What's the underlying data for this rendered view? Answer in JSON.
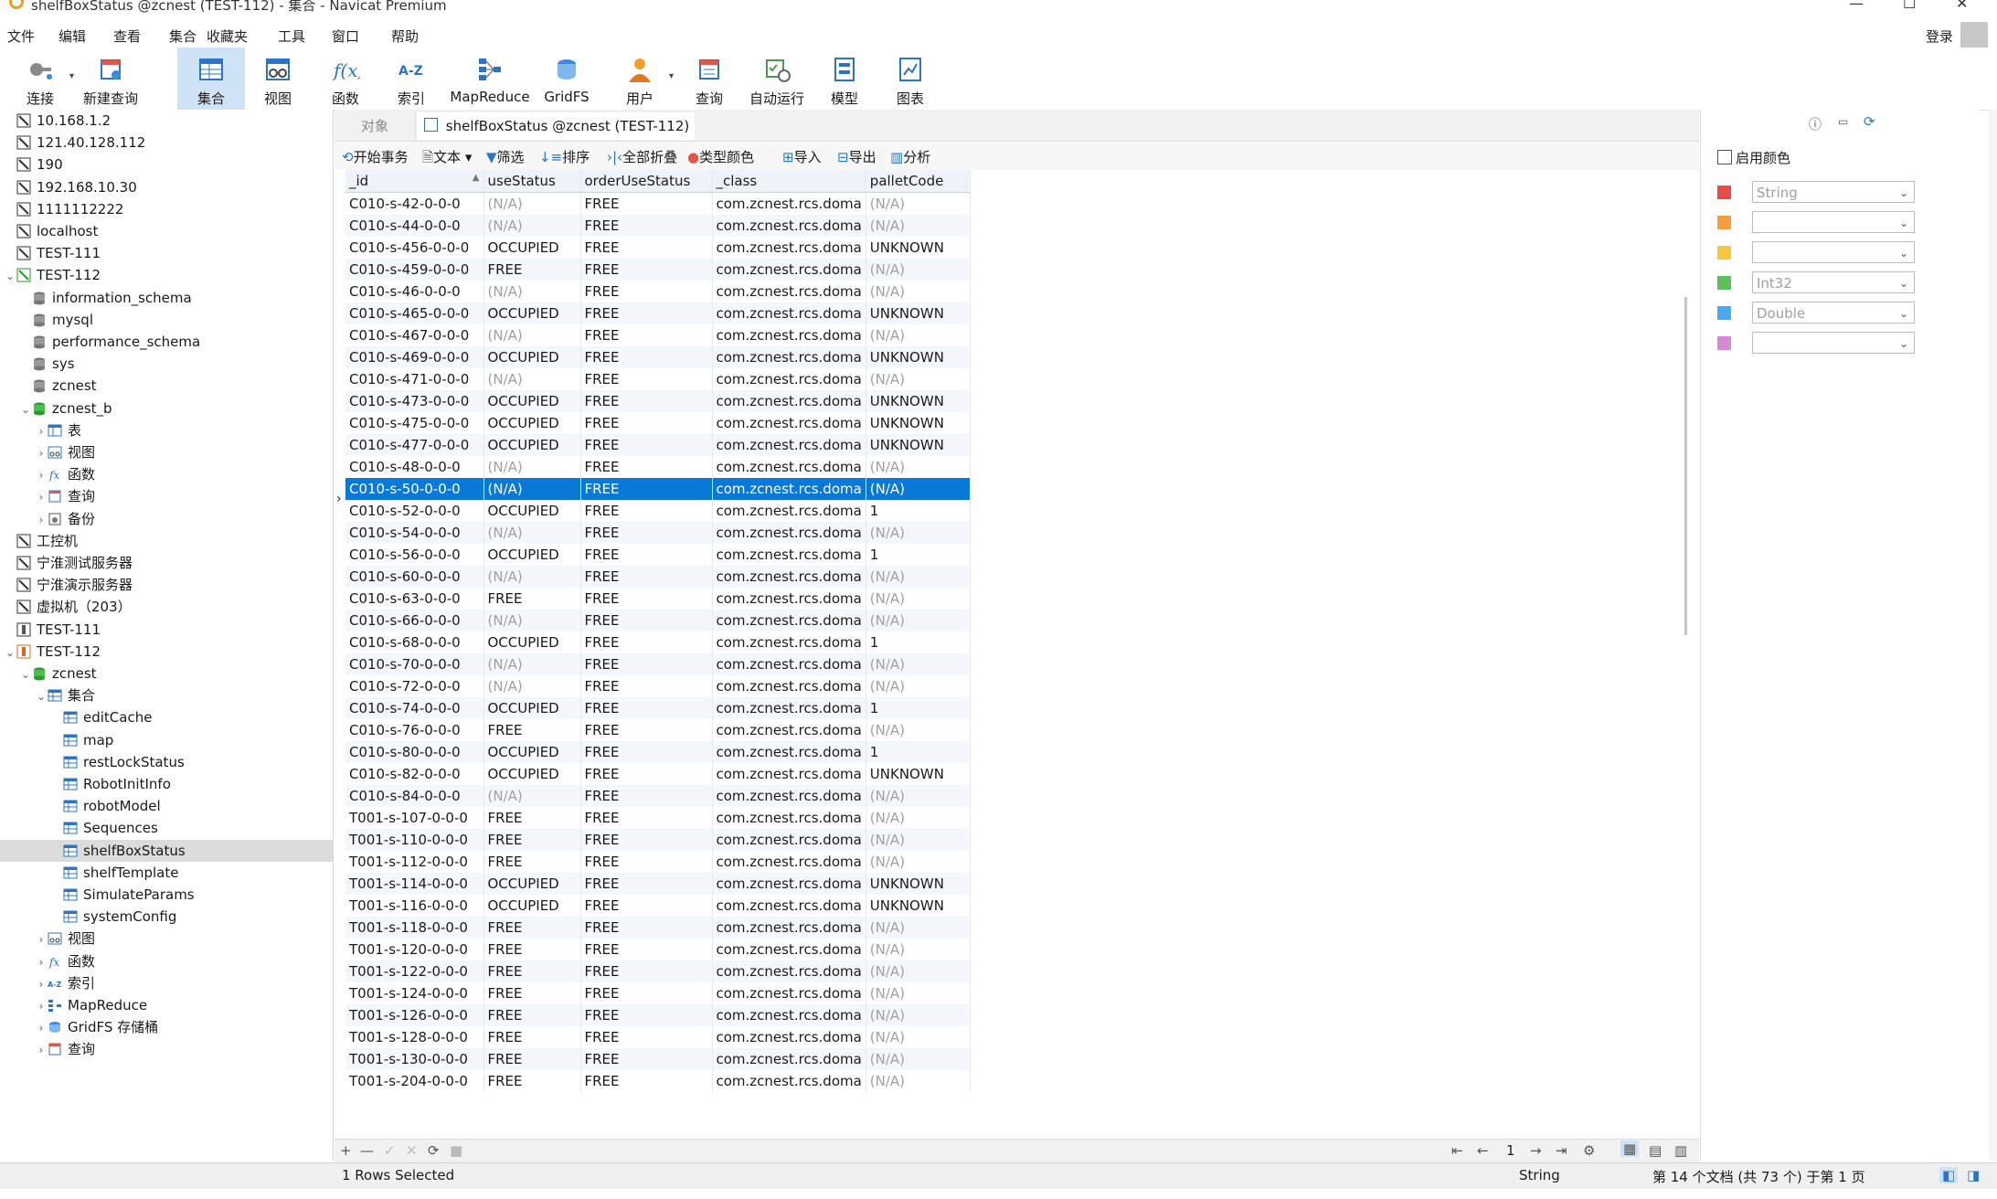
{
  "window": {
    "title": "shelfBoxStatus @zcnest (TEST-112) - 集合 - Navicat Premium",
    "login": "登录"
  },
  "menu": [
    "文件",
    "编辑",
    "查看",
    "集合",
    "收藏夹",
    "工具",
    "窗口",
    "帮助"
  ],
  "toolbar": {
    "connect": "连接",
    "new_query": "新建查询",
    "collection": "集合",
    "view": "视图",
    "function": "函数",
    "index": "索引",
    "mapreduce": "MapReduce",
    "gridfs": "GridFS",
    "user": "用户",
    "query": "查询",
    "automation": "自动运行",
    "model": "模型",
    "chart": "图表"
  },
  "tree": [
    {
      "label": "10.168.1.2",
      "indent": 0,
      "exp": "",
      "icon": "server-icon"
    },
    {
      "label": "121.40.128.112",
      "indent": 0,
      "exp": "",
      "icon": "server-icon"
    },
    {
      "label": "190",
      "indent": 0,
      "exp": "",
      "icon": "server-icon"
    },
    {
      "label": "192.168.10.30",
      "indent": 0,
      "exp": "",
      "icon": "server-icon"
    },
    {
      "label": "1111112222",
      "indent": 0,
      "exp": "",
      "icon": "server-icon"
    },
    {
      "label": "localhost",
      "indent": 0,
      "exp": "",
      "icon": "server-icon"
    },
    {
      "label": "TEST-111",
      "indent": 0,
      "exp": "",
      "icon": "server-icon"
    },
    {
      "label": "TEST-112",
      "indent": 0,
      "exp": "v",
      "icon": "server-green-icon"
    },
    {
      "label": "information_schema",
      "indent": 1,
      "exp": "",
      "icon": "database-icon"
    },
    {
      "label": "mysql",
      "indent": 1,
      "exp": "",
      "icon": "database-icon"
    },
    {
      "label": "performance_schema",
      "indent": 1,
      "exp": "",
      "icon": "database-icon"
    },
    {
      "label": "sys",
      "indent": 1,
      "exp": "",
      "icon": "database-icon"
    },
    {
      "label": "zcnest",
      "indent": 1,
      "exp": "",
      "icon": "database-icon"
    },
    {
      "label": "zcnest_b",
      "indent": 1,
      "exp": "v",
      "icon": "database-green-icon"
    },
    {
      "label": "表",
      "indent": 2,
      "exp": ">",
      "icon": "table-icon"
    },
    {
      "label": "视图",
      "indent": 2,
      "exp": ">",
      "icon": "view-icon"
    },
    {
      "label": "函数",
      "indent": 2,
      "exp": ">",
      "icon": "function-icon"
    },
    {
      "label": "查询",
      "indent": 2,
      "exp": ">",
      "icon": "query-icon"
    },
    {
      "label": "备份",
      "indent": 2,
      "exp": ">",
      "icon": "backup-icon"
    },
    {
      "label": "工控机",
      "indent": 0,
      "exp": "",
      "icon": "server-icon"
    },
    {
      "label": "宁淮测试服务器",
      "indent": 0,
      "exp": "",
      "icon": "server-icon"
    },
    {
      "label": "宁淮演示服务器",
      "indent": 0,
      "exp": "",
      "icon": "server-icon"
    },
    {
      "label": "虚拟机（203）",
      "indent": 0,
      "exp": "",
      "icon": "server-icon"
    },
    {
      "label": "TEST-111",
      "indent": 0,
      "exp": "",
      "icon": "mongo-server-icon"
    },
    {
      "label": "TEST-112",
      "indent": 0,
      "exp": "v",
      "icon": "mongo-server-orange-icon"
    },
    {
      "label": "zcnest",
      "indent": 1,
      "exp": "v",
      "icon": "database-green-icon"
    },
    {
      "label": "集合",
      "indent": 2,
      "exp": "v",
      "icon": "collection-icon"
    },
    {
      "label": "editCache",
      "indent": 3,
      "exp": "",
      "icon": "collection-icon"
    },
    {
      "label": "map",
      "indent": 3,
      "exp": "",
      "icon": "collection-icon"
    },
    {
      "label": "restLockStatus",
      "indent": 3,
      "exp": "",
      "icon": "collection-icon"
    },
    {
      "label": "RobotInitInfo",
      "indent": 3,
      "exp": "",
      "icon": "collection-icon"
    },
    {
      "label": "robotModel",
      "indent": 3,
      "exp": "",
      "icon": "collection-icon"
    },
    {
      "label": "Sequences",
      "indent": 3,
      "exp": "",
      "icon": "collection-icon"
    },
    {
      "label": "shelfBoxStatus",
      "indent": 3,
      "exp": "",
      "icon": "collection-icon",
      "selected": true
    },
    {
      "label": "shelfTemplate",
      "indent": 3,
      "exp": "",
      "icon": "collection-icon"
    },
    {
      "label": "SimulateParams",
      "indent": 3,
      "exp": "",
      "icon": "collection-icon"
    },
    {
      "label": "systemConfig",
      "indent": 3,
      "exp": "",
      "icon": "collection-icon"
    },
    {
      "label": "视图",
      "indent": 2,
      "exp": ">",
      "icon": "view-icon"
    },
    {
      "label": "函数",
      "indent": 2,
      "exp": ">",
      "icon": "function-icon"
    },
    {
      "label": "索引",
      "indent": 2,
      "exp": ">",
      "icon": "index-icon"
    },
    {
      "label": "MapReduce",
      "indent": 2,
      "exp": ">",
      "icon": "mapreduce-icon"
    },
    {
      "label": "GridFS 存储桶",
      "indent": 2,
      "exp": ">",
      "icon": "gridfs-icon"
    },
    {
      "label": "查询",
      "indent": 2,
      "exp": ">",
      "icon": "query-icon"
    }
  ],
  "tabs": {
    "objects": "对象",
    "active": "shelfBoxStatus @zcnest (TEST-112) -..."
  },
  "grid_toolbar": {
    "begin_tx": "开始事务",
    "text": "文本",
    "filter": "筛选",
    "sort": "排序",
    "collapse": "全部折叠",
    "type_color": "类型颜色",
    "import": "导入",
    "export": "导出",
    "analyze": "分析"
  },
  "grid": {
    "columns": [
      "_id",
      "useStatus",
      "orderUseStatus",
      "_class",
      "palletCode"
    ],
    "selected_index": 13,
    "rows": [
      [
        "C010-s-42-0-0-0",
        "(N/A)",
        "FREE",
        "com.zcnest.rcs.doma",
        "(N/A)"
      ],
      [
        "C010-s-44-0-0-0",
        "(N/A)",
        "FREE",
        "com.zcnest.rcs.doma",
        "(N/A)"
      ],
      [
        "C010-s-456-0-0-0",
        "OCCUPIED",
        "FREE",
        "com.zcnest.rcs.doma",
        "UNKNOWN"
      ],
      [
        "C010-s-459-0-0-0",
        "FREE",
        "FREE",
        "com.zcnest.rcs.doma",
        "(N/A)"
      ],
      [
        "C010-s-46-0-0-0",
        "(N/A)",
        "FREE",
        "com.zcnest.rcs.doma",
        "(N/A)"
      ],
      [
        "C010-s-465-0-0-0",
        "OCCUPIED",
        "FREE",
        "com.zcnest.rcs.doma",
        "UNKNOWN"
      ],
      [
        "C010-s-467-0-0-0",
        "(N/A)",
        "FREE",
        "com.zcnest.rcs.doma",
        "(N/A)"
      ],
      [
        "C010-s-469-0-0-0",
        "OCCUPIED",
        "FREE",
        "com.zcnest.rcs.doma",
        "UNKNOWN"
      ],
      [
        "C010-s-471-0-0-0",
        "(N/A)",
        "FREE",
        "com.zcnest.rcs.doma",
        "(N/A)"
      ],
      [
        "C010-s-473-0-0-0",
        "OCCUPIED",
        "FREE",
        "com.zcnest.rcs.doma",
        "UNKNOWN"
      ],
      [
        "C010-s-475-0-0-0",
        "OCCUPIED",
        "FREE",
        "com.zcnest.rcs.doma",
        "UNKNOWN"
      ],
      [
        "C010-s-477-0-0-0",
        "OCCUPIED",
        "FREE",
        "com.zcnest.rcs.doma",
        "UNKNOWN"
      ],
      [
        "C010-s-48-0-0-0",
        "(N/A)",
        "FREE",
        "com.zcnest.rcs.doma",
        "(N/A)"
      ],
      [
        "C010-s-50-0-0-0",
        "(N/A)",
        "FREE",
        "com.zcnest.rcs.doma",
        "(N/A)"
      ],
      [
        "C010-s-52-0-0-0",
        "OCCUPIED",
        "FREE",
        "com.zcnest.rcs.doma",
        "1"
      ],
      [
        "C010-s-54-0-0-0",
        "(N/A)",
        "FREE",
        "com.zcnest.rcs.doma",
        "(N/A)"
      ],
      [
        "C010-s-56-0-0-0",
        "OCCUPIED",
        "FREE",
        "com.zcnest.rcs.doma",
        "1"
      ],
      [
        "C010-s-60-0-0-0",
        "(N/A)",
        "FREE",
        "com.zcnest.rcs.doma",
        "(N/A)"
      ],
      [
        "C010-s-63-0-0-0",
        "FREE",
        "FREE",
        "com.zcnest.rcs.doma",
        "(N/A)"
      ],
      [
        "C010-s-66-0-0-0",
        "(N/A)",
        "FREE",
        "com.zcnest.rcs.doma",
        "(N/A)"
      ],
      [
        "C010-s-68-0-0-0",
        "OCCUPIED",
        "FREE",
        "com.zcnest.rcs.doma",
        "1"
      ],
      [
        "C010-s-70-0-0-0",
        "(N/A)",
        "FREE",
        "com.zcnest.rcs.doma",
        "(N/A)"
      ],
      [
        "C010-s-72-0-0-0",
        "(N/A)",
        "FREE",
        "com.zcnest.rcs.doma",
        "(N/A)"
      ],
      [
        "C010-s-74-0-0-0",
        "OCCUPIED",
        "FREE",
        "com.zcnest.rcs.doma",
        "1"
      ],
      [
        "C010-s-76-0-0-0",
        "FREE",
        "FREE",
        "com.zcnest.rcs.doma",
        "(N/A)"
      ],
      [
        "C010-s-80-0-0-0",
        "OCCUPIED",
        "FREE",
        "com.zcnest.rcs.doma",
        "1"
      ],
      [
        "C010-s-82-0-0-0",
        "OCCUPIED",
        "FREE",
        "com.zcnest.rcs.doma",
        "UNKNOWN"
      ],
      [
        "C010-s-84-0-0-0",
        "(N/A)",
        "FREE",
        "com.zcnest.rcs.doma",
        "(N/A)"
      ],
      [
        "T001-s-107-0-0-0",
        "FREE",
        "FREE",
        "com.zcnest.rcs.doma",
        "(N/A)"
      ],
      [
        "T001-s-110-0-0-0",
        "FREE",
        "FREE",
        "com.zcnest.rcs.doma",
        "(N/A)"
      ],
      [
        "T001-s-112-0-0-0",
        "FREE",
        "FREE",
        "com.zcnest.rcs.doma",
        "(N/A)"
      ],
      [
        "T001-s-114-0-0-0",
        "OCCUPIED",
        "FREE",
        "com.zcnest.rcs.doma",
        "UNKNOWN"
      ],
      [
        "T001-s-116-0-0-0",
        "OCCUPIED",
        "FREE",
        "com.zcnest.rcs.doma",
        "UNKNOWN"
      ],
      [
        "T001-s-118-0-0-0",
        "FREE",
        "FREE",
        "com.zcnest.rcs.doma",
        "(N/A)"
      ],
      [
        "T001-s-120-0-0-0",
        "FREE",
        "FREE",
        "com.zcnest.rcs.doma",
        "(N/A)"
      ],
      [
        "T001-s-122-0-0-0",
        "FREE",
        "FREE",
        "com.zcnest.rcs.doma",
        "(N/A)"
      ],
      [
        "T001-s-124-0-0-0",
        "FREE",
        "FREE",
        "com.zcnest.rcs.doma",
        "(N/A)"
      ],
      [
        "T001-s-126-0-0-0",
        "FREE",
        "FREE",
        "com.zcnest.rcs.doma",
        "(N/A)"
      ],
      [
        "T001-s-128-0-0-0",
        "FREE",
        "FREE",
        "com.zcnest.rcs.doma",
        "(N/A)"
      ],
      [
        "T001-s-130-0-0-0",
        "FREE",
        "FREE",
        "com.zcnest.rcs.doma",
        "(N/A)"
      ],
      [
        "T001-s-204-0-0-0",
        "FREE",
        "FREE",
        "com.zcnest.rcs.doma",
        "(N/A)"
      ]
    ]
  },
  "right_panel": {
    "enable_color": "启用颜色",
    "color_rules": [
      {
        "color": "#e84c4c",
        "value": "String"
      },
      {
        "color": "#f5a040",
        "value": ""
      },
      {
        "color": "#f5c842",
        "value": ""
      },
      {
        "color": "#5cc05c",
        "value": "Int32"
      },
      {
        "color": "#4aa8ee",
        "value": "Double"
      },
      {
        "color": "#d68ad6",
        "value": ""
      }
    ]
  },
  "navbar": {
    "page": "1"
  },
  "status": {
    "selection": "1 Rows Selected",
    "type": "String",
    "position": "第 14 个文档 (共 73 个) 于第 1 页"
  },
  "colors": {
    "accent": "#0a78d7",
    "toolbar_active": "#cfe3f7",
    "na_text": "#a0a0a0"
  }
}
